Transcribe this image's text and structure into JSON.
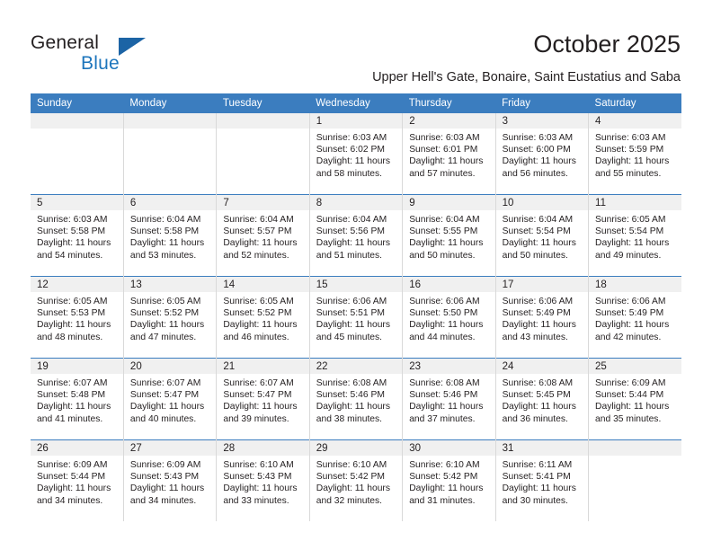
{
  "brand": {
    "name_line1": "General",
    "name_line2": "Blue",
    "logo_icon": "triangle-logo-icon",
    "color_dark": "#231f20",
    "color_blue": "#1c75bc"
  },
  "header": {
    "title": "October 2025",
    "subtitle": "Upper Hell's Gate, Bonaire, Saint Eustatius and Saba"
  },
  "colors": {
    "header_row_bg": "#3b7dbf",
    "daynum_band_bg": "#f0f0f0",
    "row_divider": "#3b7dbf",
    "text": "#231f20"
  },
  "calendar": {
    "weekday_headers": [
      "Sunday",
      "Monday",
      "Tuesday",
      "Wednesday",
      "Thursday",
      "Friday",
      "Saturday"
    ],
    "weeks": [
      [
        {
          "day": "",
          "empty": true,
          "sunrise": "",
          "sunset": "",
          "daylight": ""
        },
        {
          "day": "",
          "empty": true,
          "sunrise": "",
          "sunset": "",
          "daylight": ""
        },
        {
          "day": "",
          "empty": true,
          "sunrise": "",
          "sunset": "",
          "daylight": ""
        },
        {
          "day": "1",
          "empty": false,
          "sunrise": "Sunrise: 6:03 AM",
          "sunset": "Sunset: 6:02 PM",
          "daylight": "Daylight: 11 hours and 58 minutes."
        },
        {
          "day": "2",
          "empty": false,
          "sunrise": "Sunrise: 6:03 AM",
          "sunset": "Sunset: 6:01 PM",
          "daylight": "Daylight: 11 hours and 57 minutes."
        },
        {
          "day": "3",
          "empty": false,
          "sunrise": "Sunrise: 6:03 AM",
          "sunset": "Sunset: 6:00 PM",
          "daylight": "Daylight: 11 hours and 56 minutes."
        },
        {
          "day": "4",
          "empty": false,
          "sunrise": "Sunrise: 6:03 AM",
          "sunset": "Sunset: 5:59 PM",
          "daylight": "Daylight: 11 hours and 55 minutes."
        }
      ],
      [
        {
          "day": "5",
          "empty": false,
          "sunrise": "Sunrise: 6:03 AM",
          "sunset": "Sunset: 5:58 PM",
          "daylight": "Daylight: 11 hours and 54 minutes."
        },
        {
          "day": "6",
          "empty": false,
          "sunrise": "Sunrise: 6:04 AM",
          "sunset": "Sunset: 5:58 PM",
          "daylight": "Daylight: 11 hours and 53 minutes."
        },
        {
          "day": "7",
          "empty": false,
          "sunrise": "Sunrise: 6:04 AM",
          "sunset": "Sunset: 5:57 PM",
          "daylight": "Daylight: 11 hours and 52 minutes."
        },
        {
          "day": "8",
          "empty": false,
          "sunrise": "Sunrise: 6:04 AM",
          "sunset": "Sunset: 5:56 PM",
          "daylight": "Daylight: 11 hours and 51 minutes."
        },
        {
          "day": "9",
          "empty": false,
          "sunrise": "Sunrise: 6:04 AM",
          "sunset": "Sunset: 5:55 PM",
          "daylight": "Daylight: 11 hours and 50 minutes."
        },
        {
          "day": "10",
          "empty": false,
          "sunrise": "Sunrise: 6:04 AM",
          "sunset": "Sunset: 5:54 PM",
          "daylight": "Daylight: 11 hours and 50 minutes."
        },
        {
          "day": "11",
          "empty": false,
          "sunrise": "Sunrise: 6:05 AM",
          "sunset": "Sunset: 5:54 PM",
          "daylight": "Daylight: 11 hours and 49 minutes."
        }
      ],
      [
        {
          "day": "12",
          "empty": false,
          "sunrise": "Sunrise: 6:05 AM",
          "sunset": "Sunset: 5:53 PM",
          "daylight": "Daylight: 11 hours and 48 minutes."
        },
        {
          "day": "13",
          "empty": false,
          "sunrise": "Sunrise: 6:05 AM",
          "sunset": "Sunset: 5:52 PM",
          "daylight": "Daylight: 11 hours and 47 minutes."
        },
        {
          "day": "14",
          "empty": false,
          "sunrise": "Sunrise: 6:05 AM",
          "sunset": "Sunset: 5:52 PM",
          "daylight": "Daylight: 11 hours and 46 minutes."
        },
        {
          "day": "15",
          "empty": false,
          "sunrise": "Sunrise: 6:06 AM",
          "sunset": "Sunset: 5:51 PM",
          "daylight": "Daylight: 11 hours and 45 minutes."
        },
        {
          "day": "16",
          "empty": false,
          "sunrise": "Sunrise: 6:06 AM",
          "sunset": "Sunset: 5:50 PM",
          "daylight": "Daylight: 11 hours and 44 minutes."
        },
        {
          "day": "17",
          "empty": false,
          "sunrise": "Sunrise: 6:06 AM",
          "sunset": "Sunset: 5:49 PM",
          "daylight": "Daylight: 11 hours and 43 minutes."
        },
        {
          "day": "18",
          "empty": false,
          "sunrise": "Sunrise: 6:06 AM",
          "sunset": "Sunset: 5:49 PM",
          "daylight": "Daylight: 11 hours and 42 minutes."
        }
      ],
      [
        {
          "day": "19",
          "empty": false,
          "sunrise": "Sunrise: 6:07 AM",
          "sunset": "Sunset: 5:48 PM",
          "daylight": "Daylight: 11 hours and 41 minutes."
        },
        {
          "day": "20",
          "empty": false,
          "sunrise": "Sunrise: 6:07 AM",
          "sunset": "Sunset: 5:47 PM",
          "daylight": "Daylight: 11 hours and 40 minutes."
        },
        {
          "day": "21",
          "empty": false,
          "sunrise": "Sunrise: 6:07 AM",
          "sunset": "Sunset: 5:47 PM",
          "daylight": "Daylight: 11 hours and 39 minutes."
        },
        {
          "day": "22",
          "empty": false,
          "sunrise": "Sunrise: 6:08 AM",
          "sunset": "Sunset: 5:46 PM",
          "daylight": "Daylight: 11 hours and 38 minutes."
        },
        {
          "day": "23",
          "empty": false,
          "sunrise": "Sunrise: 6:08 AM",
          "sunset": "Sunset: 5:46 PM",
          "daylight": "Daylight: 11 hours and 37 minutes."
        },
        {
          "day": "24",
          "empty": false,
          "sunrise": "Sunrise: 6:08 AM",
          "sunset": "Sunset: 5:45 PM",
          "daylight": "Daylight: 11 hours and 36 minutes."
        },
        {
          "day": "25",
          "empty": false,
          "sunrise": "Sunrise: 6:09 AM",
          "sunset": "Sunset: 5:44 PM",
          "daylight": "Daylight: 11 hours and 35 minutes."
        }
      ],
      [
        {
          "day": "26",
          "empty": false,
          "sunrise": "Sunrise: 6:09 AM",
          "sunset": "Sunset: 5:44 PM",
          "daylight": "Daylight: 11 hours and 34 minutes."
        },
        {
          "day": "27",
          "empty": false,
          "sunrise": "Sunrise: 6:09 AM",
          "sunset": "Sunset: 5:43 PM",
          "daylight": "Daylight: 11 hours and 34 minutes."
        },
        {
          "day": "28",
          "empty": false,
          "sunrise": "Sunrise: 6:10 AM",
          "sunset": "Sunset: 5:43 PM",
          "daylight": "Daylight: 11 hours and 33 minutes."
        },
        {
          "day": "29",
          "empty": false,
          "sunrise": "Sunrise: 6:10 AM",
          "sunset": "Sunset: 5:42 PM",
          "daylight": "Daylight: 11 hours and 32 minutes."
        },
        {
          "day": "30",
          "empty": false,
          "sunrise": "Sunrise: 6:10 AM",
          "sunset": "Sunset: 5:42 PM",
          "daylight": "Daylight: 11 hours and 31 minutes."
        },
        {
          "day": "31",
          "empty": false,
          "sunrise": "Sunrise: 6:11 AM",
          "sunset": "Sunset: 5:41 PM",
          "daylight": "Daylight: 11 hours and 30 minutes."
        },
        {
          "day": "",
          "empty": true,
          "sunrise": "",
          "sunset": "",
          "daylight": ""
        }
      ]
    ]
  }
}
